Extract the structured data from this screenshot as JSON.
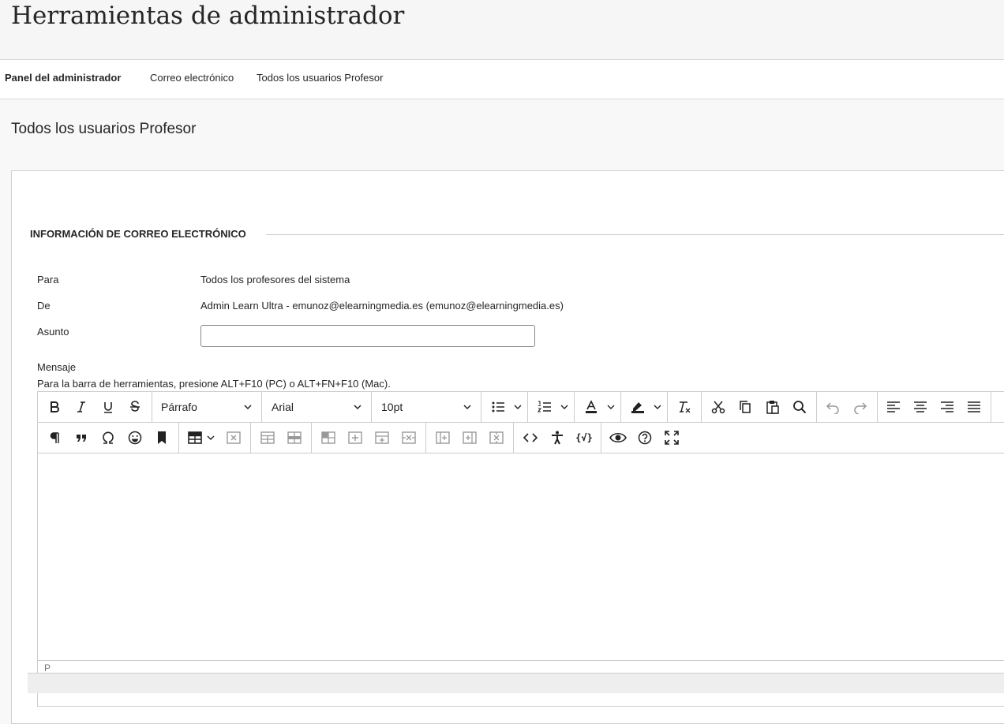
{
  "header": {
    "title": "Herramientas de administrador"
  },
  "breadcrumb": {
    "items": [
      {
        "label": "Panel del administrador"
      },
      {
        "label": "Correo electrónico"
      },
      {
        "label": "Todos los usuarios Profesor"
      }
    ]
  },
  "page": {
    "section_title": "Todos los usuarios Profesor"
  },
  "form": {
    "legend": "INFORMACIÓN DE CORREO ELECTRÓNICO",
    "to_label": "Para",
    "to_value": "Todos los profesores del sistema",
    "from_label": "De",
    "from_value": "Admin Learn Ultra - emunoz@elearningmedia.es (emunoz@elearningmedia.es)",
    "subject_label": "Asunto",
    "subject_value": "",
    "message_label": "Mensaje",
    "toolbar_hint": "Para la barra de herramientas, presione ALT+F10 (PC) o ALT+FN+F10 (Mac)."
  },
  "editor": {
    "block_format": "Párrafo",
    "font_family": "Arial",
    "font_size": "10pt",
    "status_path": "P",
    "icons_row1": [
      "bold-icon",
      "italic-icon",
      "underline-icon",
      "strikethrough-icon",
      "bullet-list-icon",
      "numbered-list-icon",
      "text-color-icon",
      "highlight-icon",
      "clear-format-icon",
      "cut-icon",
      "copy-icon",
      "paste-icon",
      "search-icon",
      "undo-icon",
      "redo-icon",
      "align-left-icon",
      "align-center-icon",
      "align-right-icon",
      "justify-icon"
    ],
    "icons_row2": [
      "paragraph-mark-icon",
      "blockquote-icon",
      "omega-icon",
      "emoji-icon",
      "bookmark-icon",
      "table-icon",
      "delete-table-icon",
      "table-props-icon",
      "row-props-icon",
      "cell-props-icon",
      "insert-row-before-icon",
      "insert-row-after-icon",
      "delete-row-icon",
      "insert-col-before-icon",
      "insert-col-after-icon",
      "delete-col-icon",
      "code-icon",
      "accessibility-icon",
      "math-icon",
      "preview-icon",
      "help-icon",
      "fullscreen-icon"
    ],
    "colors": {
      "text": "#222222",
      "disabled": "#999999",
      "border": "#cccccc"
    }
  }
}
